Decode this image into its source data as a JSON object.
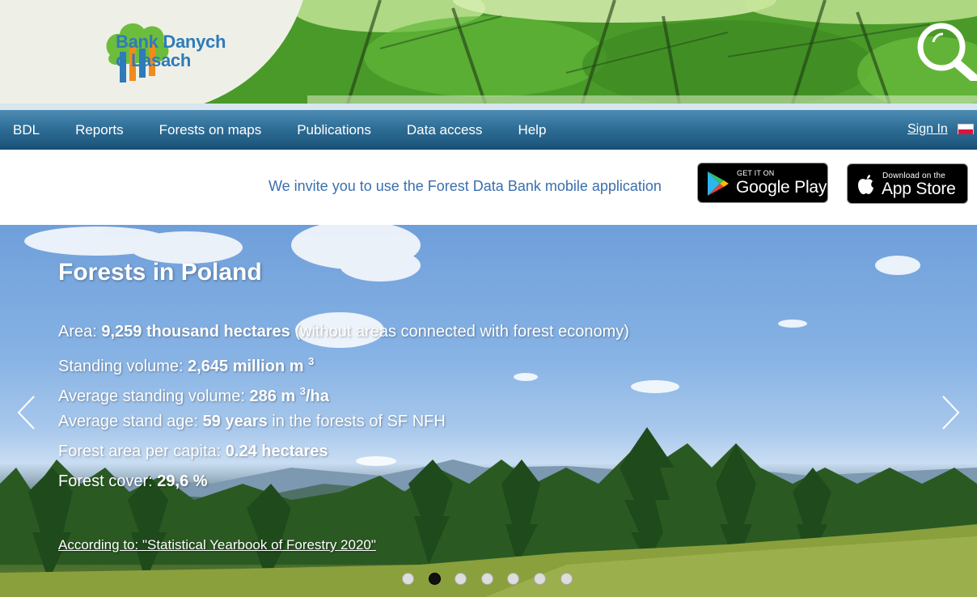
{
  "header": {
    "logo_line1": "Bank Danych",
    "logo_line2": "o Lasach",
    "search_icon": "search-icon"
  },
  "nav": {
    "items": [
      {
        "label": "BDL"
      },
      {
        "label": "Reports"
      },
      {
        "label": "Forests on maps"
      },
      {
        "label": "Publications"
      },
      {
        "label": "Data access"
      },
      {
        "label": "Help"
      }
    ],
    "signin": "Sign In",
    "flag_icon": "polish-flag-icon"
  },
  "app_strip": {
    "invite": "We invite you to use the Forest Data Bank mobile application",
    "google_play": {
      "small": "GET IT ON",
      "big": "Google Play"
    },
    "app_store": {
      "small": "Download on the",
      "big": "App Store"
    }
  },
  "hero": {
    "title": "Forests in Poland",
    "area": {
      "label": "Area: ",
      "value": "9,259 thousand hectares",
      "suffix": " (without areas connected with forest economy)"
    },
    "standing_volume": {
      "label": "Standing volume: ",
      "value": "2,645 million m",
      "sup": "3"
    },
    "avg_standing_volume": {
      "label": "Average standing volume: ",
      "value": "286 m",
      "sup": "3",
      "value_suffix": "/ha"
    },
    "avg_stand_age": {
      "label": "Average stand age: ",
      "value": "59 years",
      "suffix": " in the forests of SF NFH"
    },
    "area_per_capita": {
      "label": "Forest area per capita: ",
      "value": "0.24 hectares"
    },
    "forest_cover": {
      "label": "Forest cover: ",
      "value": "29,6 %"
    },
    "source": "According to: \"Statistical Yearbook of Forestry 2020\"",
    "slide_count": 7,
    "active_slide": 2
  },
  "colors": {
    "nav_bar": "#1f5a80",
    "logo_blue": "#2e7bb8",
    "invite_text": "#3a6fad"
  }
}
